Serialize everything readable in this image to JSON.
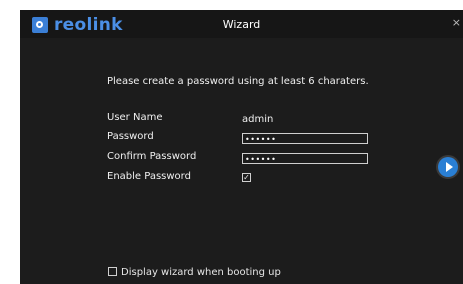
{
  "app": {
    "logo_text": "reolink",
    "window_title": "Wizard",
    "close_glyph": "×"
  },
  "form": {
    "instruction": "Please create a password using at least 6 charaters.",
    "username_label": "User Name",
    "username_value": "admin",
    "password_label": "Password",
    "password_value": "••••••",
    "confirm_label": "Confirm Password",
    "confirm_value": "••••••",
    "enable_label": "Enable Password",
    "enable_checked": true,
    "enable_glyph": "✓"
  },
  "footer": {
    "display_wizard_label": "Display wizard when booting up",
    "display_wizard_checked": false
  },
  "icons": {
    "next": "next-arrow-icon",
    "logo": "reolink-logo-icon"
  },
  "colors": {
    "accent": "#2a7fd4",
    "logo": "#4b8fe6",
    "background": "#1c1c1c"
  }
}
